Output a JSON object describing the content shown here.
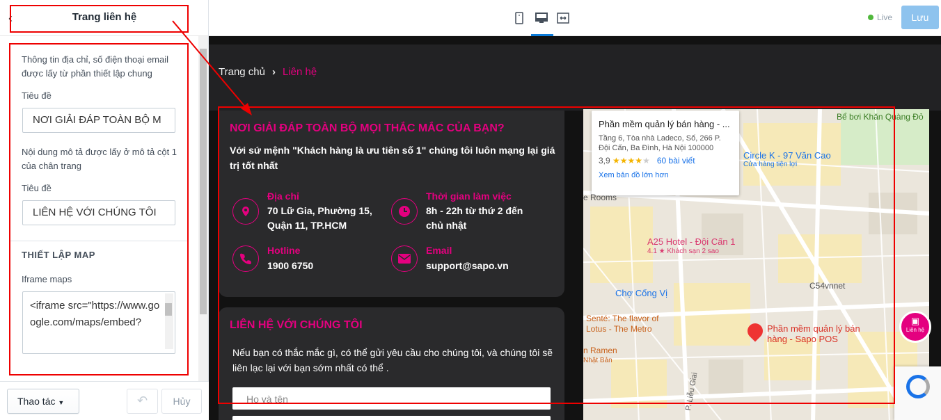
{
  "panel": {
    "title": "Trang liên hệ",
    "info_text": "Thông tin địa chỉ, số điện thoại email được lấy từ phần thiết lập chung",
    "field1_label": "Tiêu đề",
    "field1_value": "NƠI GIẢI ĐÁP TOÀN BỘ M",
    "info_text2": "Nội dung mô tả được lấy ở mô tả cột 1 của chân trang",
    "field2_label": "Tiêu đề",
    "field2_value": "LIÊN HỆ VỚI CHÚNG TÔI",
    "map_section_title": "THIẾT LẬP MAP",
    "iframe_label": "Iframe maps",
    "iframe_value": "<iframe src=\"https://www.google.com/maps/embed?"
  },
  "footer": {
    "actions_label": "Thao tác",
    "cancel_label": "Hủy"
  },
  "topbar": {
    "live_label": "Live",
    "save_label": "Lưu"
  },
  "preview": {
    "breadcrumb_home": "Trang chủ",
    "breadcrumb_current": "Liên hệ",
    "faq_title": "NƠI GIẢI ĐÁP TOÀN BỘ MỌI THẮC MẮC CỦA BẠN?",
    "faq_desc": "Với sứ mệnh \"Khách hàng là ưu tiên số 1\" chúng tôi luôn mạng lại giá trị tốt nhất",
    "address_label": "Địa chỉ",
    "address_value": "70 Lữ Gia, Phường 15, Quận 11, TP.HCM",
    "hours_label": "Thời gian làm việc",
    "hours_value": "8h - 22h từ thứ 2 đến chủ nhật",
    "hotline_label": "Hotline",
    "hotline_value": "1900 6750",
    "email_label": "Email",
    "email_value": "support@sapo.vn",
    "contact_title": "LIÊN HỆ VỚI CHÚNG TÔI",
    "contact_desc": "Nếu bạn có thắc mắc gì, có thể gửi yêu cầu cho chúng tôi, và chúng tôi sẽ liên lạc lại với bạn sớm nhất có thể .",
    "name_placeholder": "Họ và tên",
    "fab_label": "Liên hệ"
  },
  "map": {
    "place_name": "Phần mềm quản lý bán hàng - ...",
    "place_address": "Tầng 6, Tòa nhà Ladeco, Số, 266 P. Đội Cấn, Ba Đình, Hà Nội 100000",
    "rating": "3,9",
    "reviews": "60 bài viết",
    "larger_map": "Xem bản đồ lớn hơn",
    "pin_label": "Phần mềm quản lý bán hàng - Sapo POS",
    "poi_pool": "Bể bơi Khăn Quàng Đỏ",
    "poi_circlek": "Circle K - 97 Văn Cao",
    "poi_circlek_sub": "Cửa hàng tiện lợi",
    "poi_hotel": "A25 Hotel - Đội Cấn 1",
    "poi_hotel_sub": "4.1 ★ Khách sạn 2 sao",
    "poi_market": "Chợ Cống Vị",
    "poi_c54": "C54vnnet",
    "poi_sente": "Senté: The flavor of Lotus - The Metro",
    "poi_ramen": "n Ramen",
    "poi_japan": "Nhật Bản",
    "poi_rooms": "e Rooms",
    "street": "P. Liễu Giai"
  },
  "colors": {
    "accent": "#e4007f",
    "dark_bg": "#121212",
    "card_bg": "#2a2a2c",
    "save_button": "#8ec3ee",
    "annotation_red": "#e00000"
  }
}
